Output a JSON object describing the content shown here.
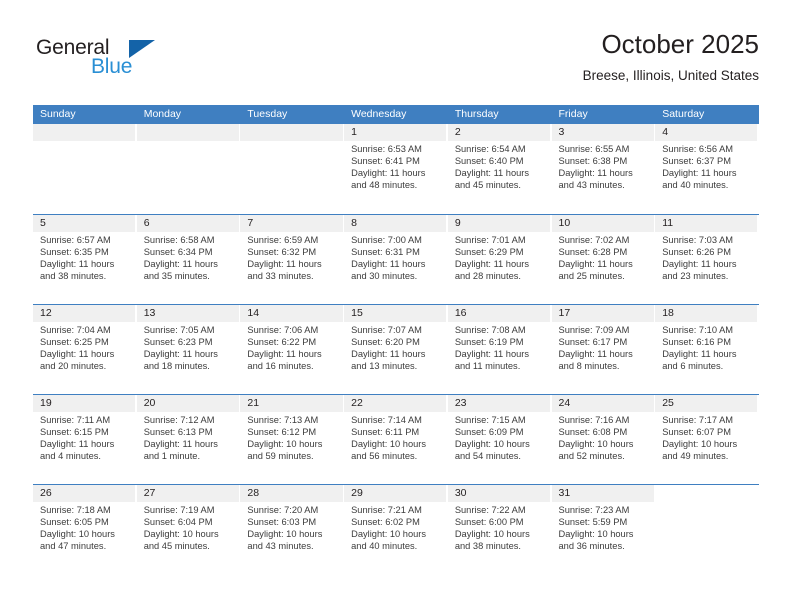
{
  "brand": {
    "name_part1": "General",
    "name_part2": "Blue",
    "triangle_icon": "triangle-icon",
    "colors": {
      "general_text": "#231f20",
      "blue_text": "#2a8fd4",
      "triangle": "#1463a8"
    }
  },
  "header": {
    "title": "October 2025",
    "subtitle": "Breese, Illinois, United States"
  },
  "theme": {
    "header_bar": "#3f7fc1",
    "day_strip": "#f0f0f0",
    "row_divider": "#3f7fc1",
    "text": "#231f20",
    "body_text": "#3c3c3c"
  },
  "weekdays": [
    "Sunday",
    "Monday",
    "Tuesday",
    "Wednesday",
    "Thursday",
    "Friday",
    "Saturday"
  ],
  "weeks": [
    [
      {
        "day": "",
        "empty": true
      },
      {
        "day": "",
        "empty": true
      },
      {
        "day": "",
        "empty": true
      },
      {
        "day": "1",
        "sunrise": "Sunrise: 6:53 AM",
        "sunset": "Sunset: 6:41 PM",
        "daylight": "Daylight: 11 hours and 48 minutes."
      },
      {
        "day": "2",
        "sunrise": "Sunrise: 6:54 AM",
        "sunset": "Sunset: 6:40 PM",
        "daylight": "Daylight: 11 hours and 45 minutes."
      },
      {
        "day": "3",
        "sunrise": "Sunrise: 6:55 AM",
        "sunset": "Sunset: 6:38 PM",
        "daylight": "Daylight: 11 hours and 43 minutes."
      },
      {
        "day": "4",
        "sunrise": "Sunrise: 6:56 AM",
        "sunset": "Sunset: 6:37 PM",
        "daylight": "Daylight: 11 hours and 40 minutes."
      }
    ],
    [
      {
        "day": "5",
        "sunrise": "Sunrise: 6:57 AM",
        "sunset": "Sunset: 6:35 PM",
        "daylight": "Daylight: 11 hours and 38 minutes."
      },
      {
        "day": "6",
        "sunrise": "Sunrise: 6:58 AM",
        "sunset": "Sunset: 6:34 PM",
        "daylight": "Daylight: 11 hours and 35 minutes."
      },
      {
        "day": "7",
        "sunrise": "Sunrise: 6:59 AM",
        "sunset": "Sunset: 6:32 PM",
        "daylight": "Daylight: 11 hours and 33 minutes."
      },
      {
        "day": "8",
        "sunrise": "Sunrise: 7:00 AM",
        "sunset": "Sunset: 6:31 PM",
        "daylight": "Daylight: 11 hours and 30 minutes."
      },
      {
        "day": "9",
        "sunrise": "Sunrise: 7:01 AM",
        "sunset": "Sunset: 6:29 PM",
        "daylight": "Daylight: 11 hours and 28 minutes."
      },
      {
        "day": "10",
        "sunrise": "Sunrise: 7:02 AM",
        "sunset": "Sunset: 6:28 PM",
        "daylight": "Daylight: 11 hours and 25 minutes."
      },
      {
        "day": "11",
        "sunrise": "Sunrise: 7:03 AM",
        "sunset": "Sunset: 6:26 PM",
        "daylight": "Daylight: 11 hours and 23 minutes."
      }
    ],
    [
      {
        "day": "12",
        "sunrise": "Sunrise: 7:04 AM",
        "sunset": "Sunset: 6:25 PM",
        "daylight": "Daylight: 11 hours and 20 minutes."
      },
      {
        "day": "13",
        "sunrise": "Sunrise: 7:05 AM",
        "sunset": "Sunset: 6:23 PM",
        "daylight": "Daylight: 11 hours and 18 minutes."
      },
      {
        "day": "14",
        "sunrise": "Sunrise: 7:06 AM",
        "sunset": "Sunset: 6:22 PM",
        "daylight": "Daylight: 11 hours and 16 minutes."
      },
      {
        "day": "15",
        "sunrise": "Sunrise: 7:07 AM",
        "sunset": "Sunset: 6:20 PM",
        "daylight": "Daylight: 11 hours and 13 minutes."
      },
      {
        "day": "16",
        "sunrise": "Sunrise: 7:08 AM",
        "sunset": "Sunset: 6:19 PM",
        "daylight": "Daylight: 11 hours and 11 minutes."
      },
      {
        "day": "17",
        "sunrise": "Sunrise: 7:09 AM",
        "sunset": "Sunset: 6:17 PM",
        "daylight": "Daylight: 11 hours and 8 minutes."
      },
      {
        "day": "18",
        "sunrise": "Sunrise: 7:10 AM",
        "sunset": "Sunset: 6:16 PM",
        "daylight": "Daylight: 11 hours and 6 minutes."
      }
    ],
    [
      {
        "day": "19",
        "sunrise": "Sunrise: 7:11 AM",
        "sunset": "Sunset: 6:15 PM",
        "daylight": "Daylight: 11 hours and 4 minutes."
      },
      {
        "day": "20",
        "sunrise": "Sunrise: 7:12 AM",
        "sunset": "Sunset: 6:13 PM",
        "daylight": "Daylight: 11 hours and 1 minute."
      },
      {
        "day": "21",
        "sunrise": "Sunrise: 7:13 AM",
        "sunset": "Sunset: 6:12 PM",
        "daylight": "Daylight: 10 hours and 59 minutes."
      },
      {
        "day": "22",
        "sunrise": "Sunrise: 7:14 AM",
        "sunset": "Sunset: 6:11 PM",
        "daylight": "Daylight: 10 hours and 56 minutes."
      },
      {
        "day": "23",
        "sunrise": "Sunrise: 7:15 AM",
        "sunset": "Sunset: 6:09 PM",
        "daylight": "Daylight: 10 hours and 54 minutes."
      },
      {
        "day": "24",
        "sunrise": "Sunrise: 7:16 AM",
        "sunset": "Sunset: 6:08 PM",
        "daylight": "Daylight: 10 hours and 52 minutes."
      },
      {
        "day": "25",
        "sunrise": "Sunrise: 7:17 AM",
        "sunset": "Sunset: 6:07 PM",
        "daylight": "Daylight: 10 hours and 49 minutes."
      }
    ],
    [
      {
        "day": "26",
        "sunrise": "Sunrise: 7:18 AM",
        "sunset": "Sunset: 6:05 PM",
        "daylight": "Daylight: 10 hours and 47 minutes."
      },
      {
        "day": "27",
        "sunrise": "Sunrise: 7:19 AM",
        "sunset": "Sunset: 6:04 PM",
        "daylight": "Daylight: 10 hours and 45 minutes."
      },
      {
        "day": "28",
        "sunrise": "Sunrise: 7:20 AM",
        "sunset": "Sunset: 6:03 PM",
        "daylight": "Daylight: 10 hours and 43 minutes."
      },
      {
        "day": "29",
        "sunrise": "Sunrise: 7:21 AM",
        "sunset": "Sunset: 6:02 PM",
        "daylight": "Daylight: 10 hours and 40 minutes."
      },
      {
        "day": "30",
        "sunrise": "Sunrise: 7:22 AM",
        "sunset": "Sunset: 6:00 PM",
        "daylight": "Daylight: 10 hours and 38 minutes."
      },
      {
        "day": "31",
        "sunrise": "Sunrise: 7:23 AM",
        "sunset": "Sunset: 5:59 PM",
        "daylight": "Daylight: 10 hours and 36 minutes."
      },
      {
        "day": "",
        "empty": true,
        "blank": true
      }
    ]
  ]
}
